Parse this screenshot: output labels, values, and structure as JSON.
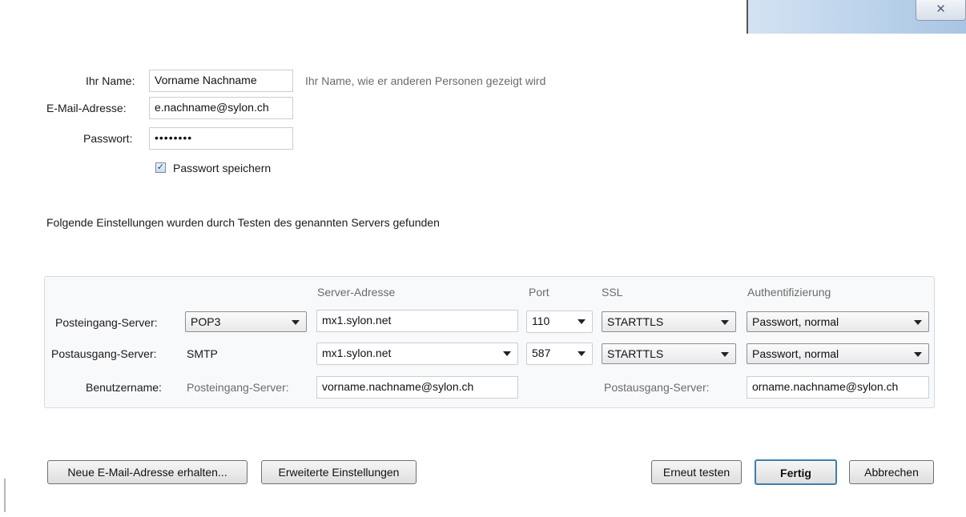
{
  "window": {
    "close_glyph": "✕"
  },
  "account": {
    "name_label": "Ihr Name:",
    "name_value": "Vorname Nachname",
    "name_hint": "Ihr Name, wie er anderen Personen gezeigt wird",
    "email_label": "E-Mail-Adresse:",
    "email_value": "e.nachname@sylon.ch",
    "password_label": "Passwort:",
    "password_value": "••••••••",
    "remember_label": "Passwort speichern",
    "remember_checked": true
  },
  "found_message": "Folgende Einstellungen wurden durch Testen des genannten Servers gefunden",
  "server_table": {
    "headers": {
      "address": "Server-Adresse",
      "port": "Port",
      "ssl": "SSL",
      "auth": "Authentifizierung"
    },
    "incoming": {
      "label": "Posteingang-Server:",
      "protocol": "POP3",
      "address": "mx1.sylon.net",
      "port": "110",
      "ssl": "STARTTLS",
      "auth": "Passwort, normal"
    },
    "outgoing": {
      "label": "Postausgang-Server:",
      "protocol": "SMTP",
      "address": "mx1.sylon.net",
      "port": "587",
      "ssl": "STARTTLS",
      "auth": "Passwort, normal"
    },
    "username": {
      "label": "Benutzername:",
      "incoming_label": "Posteingang-Server:",
      "incoming_value": "vorname.nachname@sylon.ch",
      "outgoing_label": "Postausgang-Server:",
      "outgoing_value": "orname.nachname@sylon.ch"
    }
  },
  "buttons": {
    "new_address": "Neue E-Mail-Adresse erhalten...",
    "advanced": "Erweiterte Einstellungen",
    "retest": "Erneut testen",
    "done": "Fertig",
    "cancel": "Abbrechen"
  },
  "colors": {
    "panel_bg": "#f8f9fb",
    "panel_border": "#d6dae0",
    "titlebar": "#b9d1ea"
  }
}
